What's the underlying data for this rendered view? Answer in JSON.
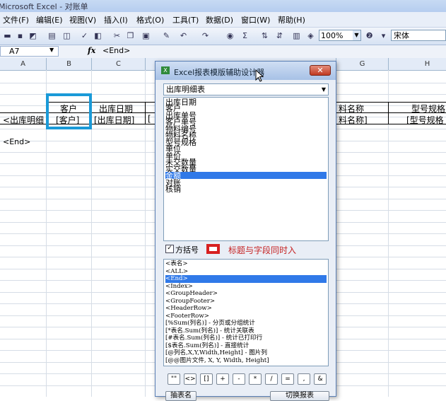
{
  "window": {
    "title": "Microsoft Excel - 对账单"
  },
  "menu": [
    "文件(F)",
    "编辑(E)",
    "视图(V)",
    "插入(I)",
    "格式(O)",
    "工具(T)",
    "数据(D)",
    "窗口(W)",
    "帮助(H)"
  ],
  "toolbar": {
    "zoom": "100%",
    "font": "宋体"
  },
  "formula_bar": {
    "cell_ref": "A7",
    "fx": "fx",
    "formula": "<End>"
  },
  "columns": [
    "A",
    "B",
    "C",
    "G",
    "H"
  ],
  "sheet": {
    "b_header": "客户",
    "c_header": "出库日期",
    "a_row": "<出库明细",
    "b_row": "[客户]",
    "c_row": "[出库日期]",
    "d_row_fragment": "[",
    "g_header": "料名称",
    "h_header": "型号规格",
    "g_row": "料名称]",
    "h_row": "[型号规格",
    "end_cell": "<End>"
  },
  "dialog": {
    "title": "Excel报表模版辅助设计器",
    "close": "✕",
    "table_select": "出库明细表",
    "fields": [
      "出库日期",
      "客户",
      "出库单号",
      "客户单号",
      "物料编号",
      "物料名称",
      "型号规格",
      "单位",
      "单价",
      "未交数量",
      "实交数量",
      "金额",
      "对账",
      "核销"
    ],
    "selected_field_index": 11,
    "checkbox_label": "方括号",
    "red_label": "标题与字段同时入",
    "tags": [
      "<表名>",
      "<ALL>",
      "<End>",
      "<Index>",
      "<GroupHeader>",
      "<GroupFooter>",
      "<HeaderRow>",
      "<FooterRow>",
      "[%Sum(列名)] - 分页或分组统计",
      "[*表名.Sum(列名)] - 统计关联表",
      "[#表名.Sum(列名)] - 统计已打印行",
      "[$表名.Sum(列名)] - 直接统计",
      "[@列名,X,Y,Width,Height] - 图片列",
      "[@@图片文件, X, Y, Width, Height]"
    ],
    "selected_tag_index": 2,
    "symbols": [
      "\"\"",
      "<>",
      "[]",
      "+",
      "-",
      "*",
      "/",
      "=",
      ",",
      "&"
    ],
    "bottom_left": "抽表名",
    "bottom_right": "切换报表"
  }
}
